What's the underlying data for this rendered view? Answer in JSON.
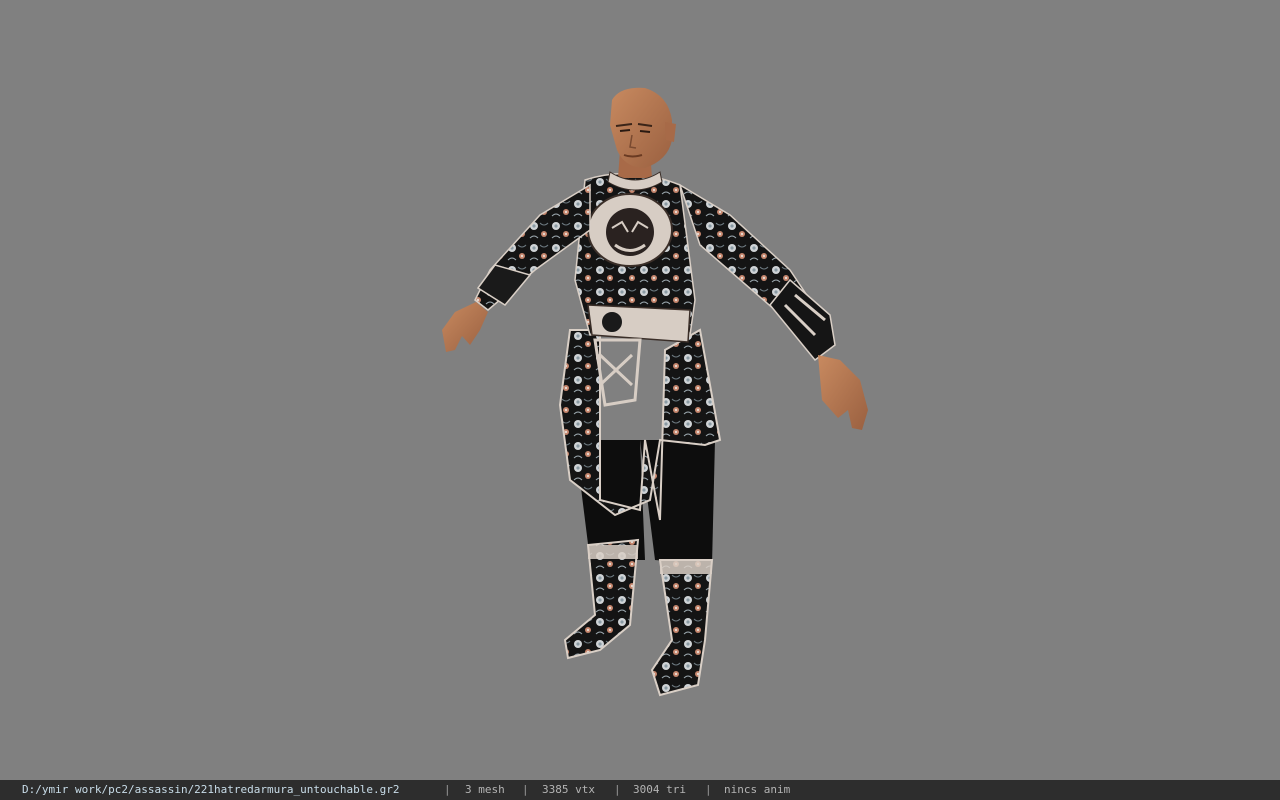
{
  "viewport": {
    "background": "#808080"
  },
  "status_bar": {
    "file_path": "D:/ymir work/pc2/assassin/221hatredarmura_untouchable.gr2",
    "separator": "|",
    "mesh_count": "3 mesh",
    "vertex_count": "3385 vtx",
    "triangle_count": "3004 tri",
    "animation": "nincs anim"
  }
}
